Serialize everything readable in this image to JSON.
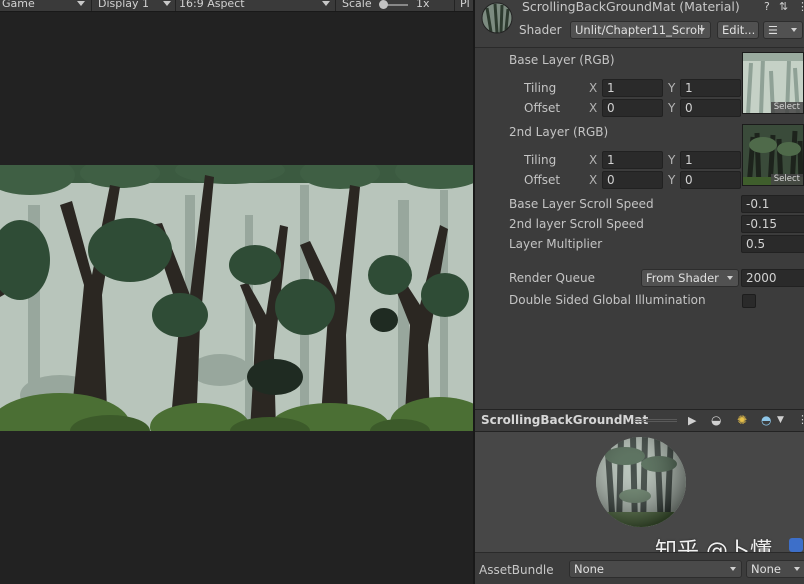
{
  "game_view": {
    "tab_label": "Game",
    "display_select": "Display 1",
    "aspect_select": "16:9 Aspect",
    "scale_label": "Scale",
    "scale_value": "1x",
    "overflow_label": "Pl"
  },
  "inspector": {
    "title": "ScrollingBackGroundMat (Material)",
    "shader_label": "Shader",
    "shader_value": "Unlit/Chapter11_Scroll",
    "edit_label": "Edit...",
    "properties": {
      "base_layer": {
        "label": "Base Layer (RGB)",
        "tiling_label": "Tiling",
        "offset_label": "Offset",
        "tiling_x": "1",
        "tiling_y": "1",
        "offset_x": "0",
        "offset_y": "0",
        "select_label": "Select"
      },
      "second_layer": {
        "label": "2nd Layer (RGB)",
        "tiling_label": "Tiling",
        "offset_label": "Offset",
        "tiling_x": "1",
        "tiling_y": "1",
        "offset_x": "0",
        "offset_y": "0",
        "select_label": "Select"
      },
      "axis_x": "X",
      "axis_y": "Y",
      "base_scroll_speed_label": "Base Layer Scroll Speed",
      "base_scroll_speed": "-0.1",
      "second_scroll_speed_label": "2nd layer Scroll Speed",
      "second_scroll_speed": "-0.15",
      "layer_multiplier_label": "Layer Multiplier",
      "layer_multiplier": "0.5",
      "render_queue_label": "Render Queue",
      "render_queue_mode": "From Shader",
      "render_queue_value": "2000",
      "dsgi_label": "Double Sided Global Illumination",
      "dsgi_checked": false
    },
    "preview": {
      "title": "ScrollingBackGroundMat"
    },
    "watermark": "知乎 @卜懂",
    "asset_bundle": {
      "label": "AssetBundle",
      "name_value": "None",
      "variant_value": "None"
    }
  },
  "colors": {
    "panel_bg": "#3c3c3c",
    "game_bg": "#222222",
    "field_bg": "#2a2a2a",
    "forest_sky": "#b8c5bb",
    "forest_dark_trunk": "#2a2620",
    "forest_canopy": "#2f4a34",
    "forest_ground": "#4a6d33"
  }
}
